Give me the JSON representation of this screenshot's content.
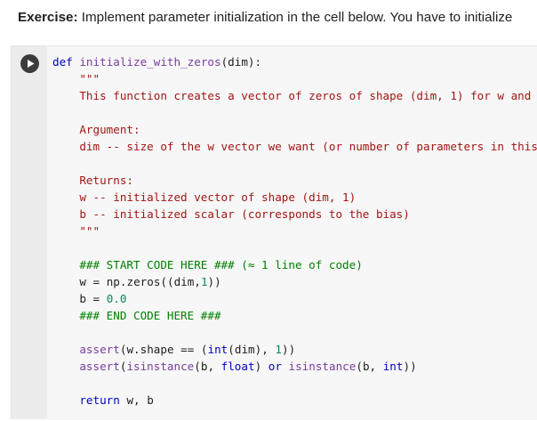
{
  "instruction": {
    "label": "Exercise:",
    "text": " Implement parameter initialization in the cell below. You have to initialize"
  },
  "cell": {
    "run_button_icon": "play-icon",
    "code_lines": [
      "def initialize_with_zeros(dim):",
      "    \"\"\"",
      "    This function creates a vector of zeros of shape (dim, 1) for w and initia",
      "",
      "    Argument:",
      "    dim -- size of the w vector we want (or number of parameters in this case)",
      "",
      "    Returns:",
      "    w -- initialized vector of shape (dim, 1)",
      "    b -- initialized scalar (corresponds to the bias)",
      "    \"\"\"",
      "",
      "    ### START CODE HERE ### (≈ 1 line of code)",
      "    w = np.zeros((dim,1))",
      "    b = 0.0",
      "    ### END CODE HERE ###",
      "",
      "    assert(w.shape == (int(dim), 1))",
      "    assert(isinstance(b, float) or isinstance(b, int))",
      "",
      "    return w, b"
    ]
  },
  "colors": {
    "keyword": "#0000c8",
    "function": "#7a3e9d",
    "string": "#a31515",
    "comment": "#008000",
    "number": "#098658"
  }
}
